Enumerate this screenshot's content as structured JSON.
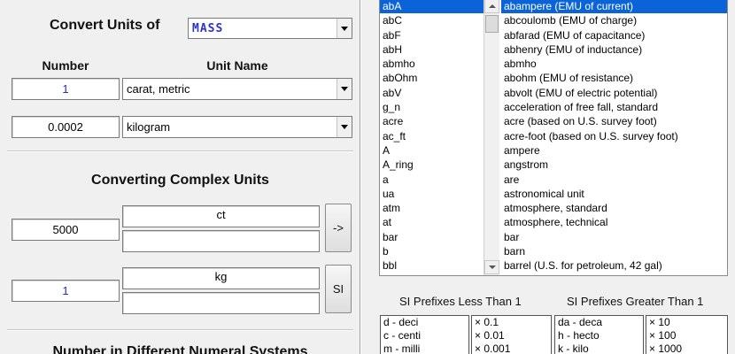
{
  "convert_units": {
    "title": "Convert Units of",
    "unit_type": "MASS"
  },
  "columns": {
    "number": "Number",
    "unit_name": "Unit Name"
  },
  "row1": {
    "number": "1",
    "unit": "carat, metric"
  },
  "row2": {
    "number": "0.0002",
    "unit": "kilogram"
  },
  "complex": {
    "title": "Converting Complex Units",
    "number1": "5000",
    "unit1": "ct",
    "unit1_extra": "",
    "convert_button": "->",
    "number2": "1",
    "unit2": "kg",
    "unit2_extra": "",
    "si_button": "SI"
  },
  "numeral_systems": {
    "title": "Number in Different Numeral Systems"
  },
  "unit_list": [
    {
      "symbol": "abA",
      "name": "abampere (EMU of current)"
    },
    {
      "symbol": "abC",
      "name": "abcoulomb (EMU of charge)"
    },
    {
      "symbol": "abF",
      "name": "abfarad (EMU of capacitance)"
    },
    {
      "symbol": "abH",
      "name": "abhenry (EMU of inductance)"
    },
    {
      "symbol": "abmho",
      "name": "abmho"
    },
    {
      "symbol": "abOhm",
      "name": "abohm (EMU of resistance)"
    },
    {
      "symbol": "abV",
      "name": "abvolt (EMU of electric potential)"
    },
    {
      "symbol": "g_n",
      "name": "acceleration of free fall, standard"
    },
    {
      "symbol": "acre",
      "name": "acre (based on U.S. survey foot)"
    },
    {
      "symbol": "ac_ft",
      "name": "acre-foot (based on U.S. survey foot)"
    },
    {
      "symbol": "A",
      "name": "ampere"
    },
    {
      "symbol": "A_ring",
      "name": "angstrom"
    },
    {
      "symbol": "a",
      "name": "are"
    },
    {
      "symbol": "ua",
      "name": "astronomical unit"
    },
    {
      "symbol": "atm",
      "name": "atmosphere, standard"
    },
    {
      "symbol": "at",
      "name": "atmosphere, technical"
    },
    {
      "symbol": "bar",
      "name": "bar"
    },
    {
      "symbol": "b",
      "name": "barn"
    },
    {
      "symbol": "bbl",
      "name": "barrel (U.S. for petroleum, 42 gal)"
    }
  ],
  "si_prefixes": {
    "less_title": "SI Prefixes Less Than 1",
    "greater_title": "SI Prefixes Greater Than 1",
    "less": [
      {
        "prefix": "d - deci",
        "factor": "× 0.1"
      },
      {
        "prefix": "c - centi",
        "factor": "× 0.01"
      },
      {
        "prefix": "m - milli",
        "factor": "× 0.001"
      }
    ],
    "greater": [
      {
        "prefix": "da - deca",
        "factor": "× 10"
      },
      {
        "prefix": "h  - hecto",
        "factor": "× 100"
      },
      {
        "prefix": "k  - kilo",
        "factor": "× 1000"
      }
    ]
  }
}
